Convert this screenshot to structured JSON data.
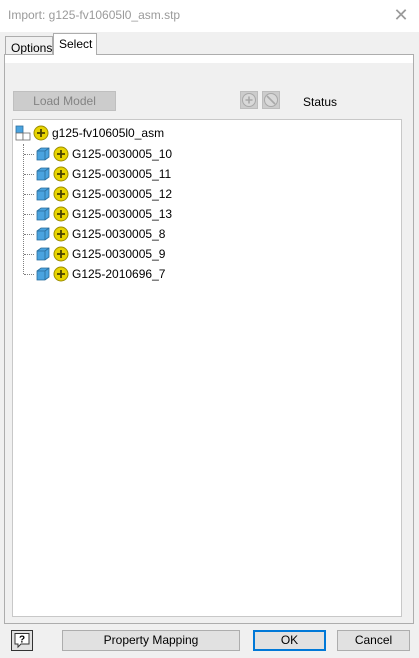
{
  "window": {
    "title": "Import:  g125-fv10605l0_asm.stp",
    "close_glyph": "✕"
  },
  "tabs": [
    {
      "label": "Options",
      "active": false
    },
    {
      "label": "Select",
      "active": true
    }
  ],
  "toolbar": {
    "load_model_label": "Load Model",
    "add_icon": "add-circle-icon",
    "ban_icon": "ban-circle-icon",
    "status_label": "Status"
  },
  "tree": {
    "root": {
      "label": "g125-fv10605l0_asm",
      "icon": "assembly-icon"
    },
    "children": [
      {
        "label": "G125-0030005_10",
        "icon": "part-icon"
      },
      {
        "label": "G125-0030005_11",
        "icon": "part-icon"
      },
      {
        "label": "G125-0030005_12",
        "icon": "part-icon"
      },
      {
        "label": "G125-0030005_13",
        "icon": "part-icon"
      },
      {
        "label": "G125-0030005_8",
        "icon": "part-icon"
      },
      {
        "label": "G125-0030005_9",
        "icon": "part-icon"
      },
      {
        "label": "G125-2010696_7",
        "icon": "part-icon"
      }
    ]
  },
  "footer": {
    "help_glyph": "?",
    "property_mapping_label": "Property Mapping",
    "ok_label": "OK",
    "cancel_label": "Cancel"
  },
  "colors": {
    "status_plus": "#e8d400",
    "part_blue": "#4aa3df",
    "focus_blue": "#0078d7"
  }
}
